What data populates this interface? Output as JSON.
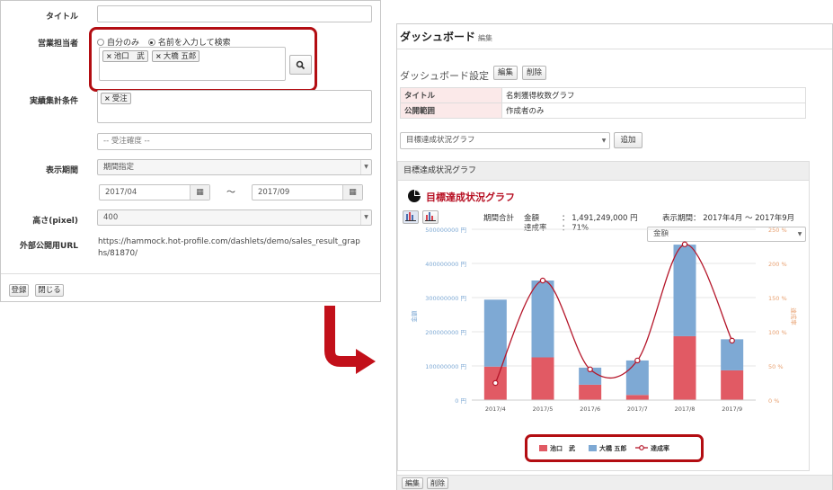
{
  "form": {
    "title_label": "タイトル",
    "title_value": "",
    "sales_label": "営業担当者",
    "radio_self": "自分のみ",
    "radio_search": "名前を入力して検索",
    "people": [
      "池口　武",
      "大橋 五郎"
    ],
    "tag_x": "×",
    "results_label": "実績集計条件",
    "condition_tag": "受注",
    "order_placeholder": "-- 受注確度 --",
    "period_label": "表示期間",
    "period_value": "期間指定",
    "date_from": "2017/04",
    "date_to": "2017/09",
    "tilde": "～",
    "height_label": "高さ(pixel)",
    "height_value": "400",
    "url_label": "外部公開用URL",
    "url_line1": "https://hammock.hot-profile.com/dashlets/demo/sales_result_grap",
    "url_line2": "hs/81870/",
    "register_button": "登録",
    "close_button": "閉じる"
  },
  "dashboard": {
    "title": "ダッシュボード",
    "edit_link": "編集",
    "settings_label": "ダッシュボード設定",
    "settings_edit": "編集",
    "settings_delete": "削除",
    "info": [
      {
        "label": "タイトル",
        "value": "名刺獲得枚数グラフ"
      },
      {
        "label": "公開範囲",
        "value": "作成者のみ"
      }
    ],
    "graph_select": "目標達成状況グラフ",
    "add_button": "追加",
    "card_header": "目標達成状況グラフ",
    "chart_title": "目標達成状況グラフ",
    "summary_label": "期間合計",
    "amount_label": "金額",
    "amount_value": "：  1,491,249,000 円",
    "rate_label": "達成率",
    "rate_value": "：  71%",
    "period_text": "表示期間： 2017年4月 ～ 2017年9月",
    "metric_select": "金額",
    "footer_edit": "編集",
    "footer_delete": "削除"
  },
  "colors": {
    "red_series": "#e15a64",
    "blue_series": "#7ea9d4",
    "rate_line": "#b5162a",
    "accent": "#b30d12"
  },
  "chart_data": {
    "type": "bar",
    "stacked": true,
    "categories": [
      "2017/4",
      "2017/5",
      "2017/6",
      "2017/7",
      "2017/8",
      "2017/9"
    ],
    "series": [
      {
        "name": "池口　武",
        "values": [
          98000000,
          125000000,
          45000000,
          15000000,
          187000000,
          87000000
        ]
      },
      {
        "name": "大橋 五郎",
        "values": [
          196000000,
          225000000,
          50000000,
          101000000,
          268000000,
          91000000
        ]
      }
    ],
    "line_series": {
      "name": "達成率",
      "values": [
        25,
        175,
        45,
        58,
        228,
        87
      ]
    },
    "y_left_ticks": [
      "0 円",
      "100000000 円",
      "200000000 円",
      "300000000 円",
      "400000000 円",
      "500000000 円"
    ],
    "y_left_label": "金額",
    "y_right_ticks": [
      "0 %",
      "50 %",
      "100 %",
      "150 %",
      "200 %",
      "250 %"
    ],
    "y_right_label": "達成率",
    "ylim_left": [
      0,
      500000000
    ],
    "ylim_right": [
      0,
      250
    ],
    "legend_placement": "bottom"
  }
}
